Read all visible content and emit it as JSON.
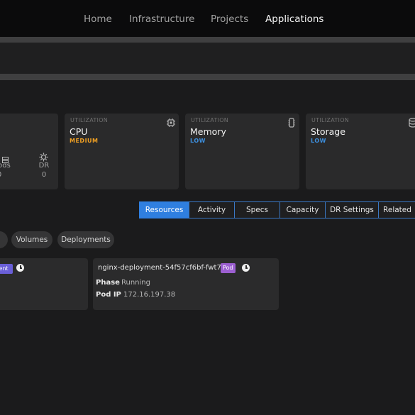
{
  "nav": {
    "items": [
      {
        "label": "Home"
      },
      {
        "label": "Infrastructure"
      },
      {
        "label": "Projects"
      },
      {
        "label": "Applications"
      }
    ],
    "active": "Applications"
  },
  "summary_card": {
    "stats": [
      {
        "icon": "server-icon",
        "label": "ods",
        "value": "0"
      },
      {
        "icon": "dr-gear-icon",
        "label": "DR",
        "value": "0"
      }
    ]
  },
  "utilization": [
    {
      "caption": "UTILIZATION",
      "name": "CPU",
      "level": "MEDIUM",
      "level_color": "#f0a023",
      "icon": "chip-icon"
    },
    {
      "caption": "UTILIZATION",
      "name": "Memory",
      "level": "LOW",
      "level_color": "#3d8fde",
      "icon": "memory-icon"
    },
    {
      "caption": "UTILIZATION",
      "name": "Storage",
      "level": "LOW",
      "level_color": "#3d8fde",
      "icon": "database-icon"
    }
  ],
  "tabs": [
    {
      "label": "Resources"
    },
    {
      "label": "Activity"
    },
    {
      "label": "Specs"
    },
    {
      "label": "Capacity"
    },
    {
      "label": "DR Settings"
    },
    {
      "label": "Related"
    }
  ],
  "active_tab": "Resources",
  "filters": [
    {
      "label": "Volumes"
    },
    {
      "label": "Deployments"
    }
  ],
  "resources": [
    {
      "badge": "ent"
    },
    {
      "name": "nginx-deployment-54f57cf6bf-fwt7p",
      "badge": "Pod",
      "phase_label": "Phase",
      "phase_value": "Running",
      "ip_label": "Pod IP",
      "ip_value": "172.16.197.38"
    }
  ],
  "accent_color": "#2f7fe0"
}
